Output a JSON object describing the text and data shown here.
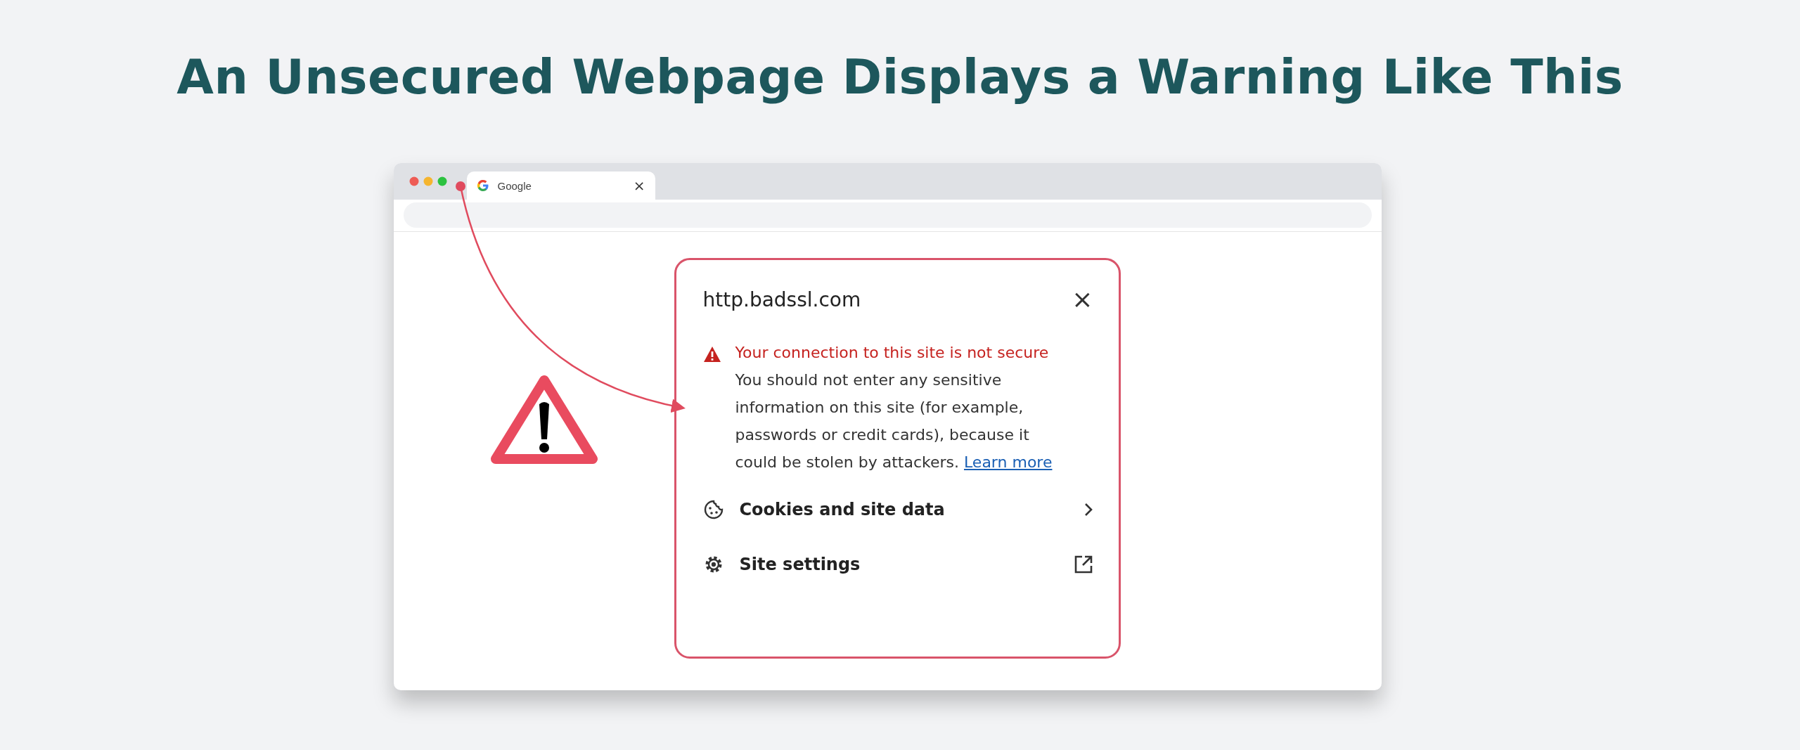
{
  "heading": "An Unsecured Webpage Displays a Warning Like This",
  "browser": {
    "tab": {
      "title": "Google",
      "close": "×",
      "selected": true
    }
  },
  "popup": {
    "site": "http.badssl.com",
    "close": "×",
    "warning": {
      "title": "Your connection to this site is not secure",
      "body": "You should not enter any sensitive information on this site (for example, passwords or credit cards), because it could be stolen by attackers.",
      "link": "Learn more"
    },
    "items": [
      {
        "label": "Cookies and site data",
        "kind": "cookies"
      },
      {
        "label": "Site settings",
        "kind": "settings"
      }
    ]
  }
}
